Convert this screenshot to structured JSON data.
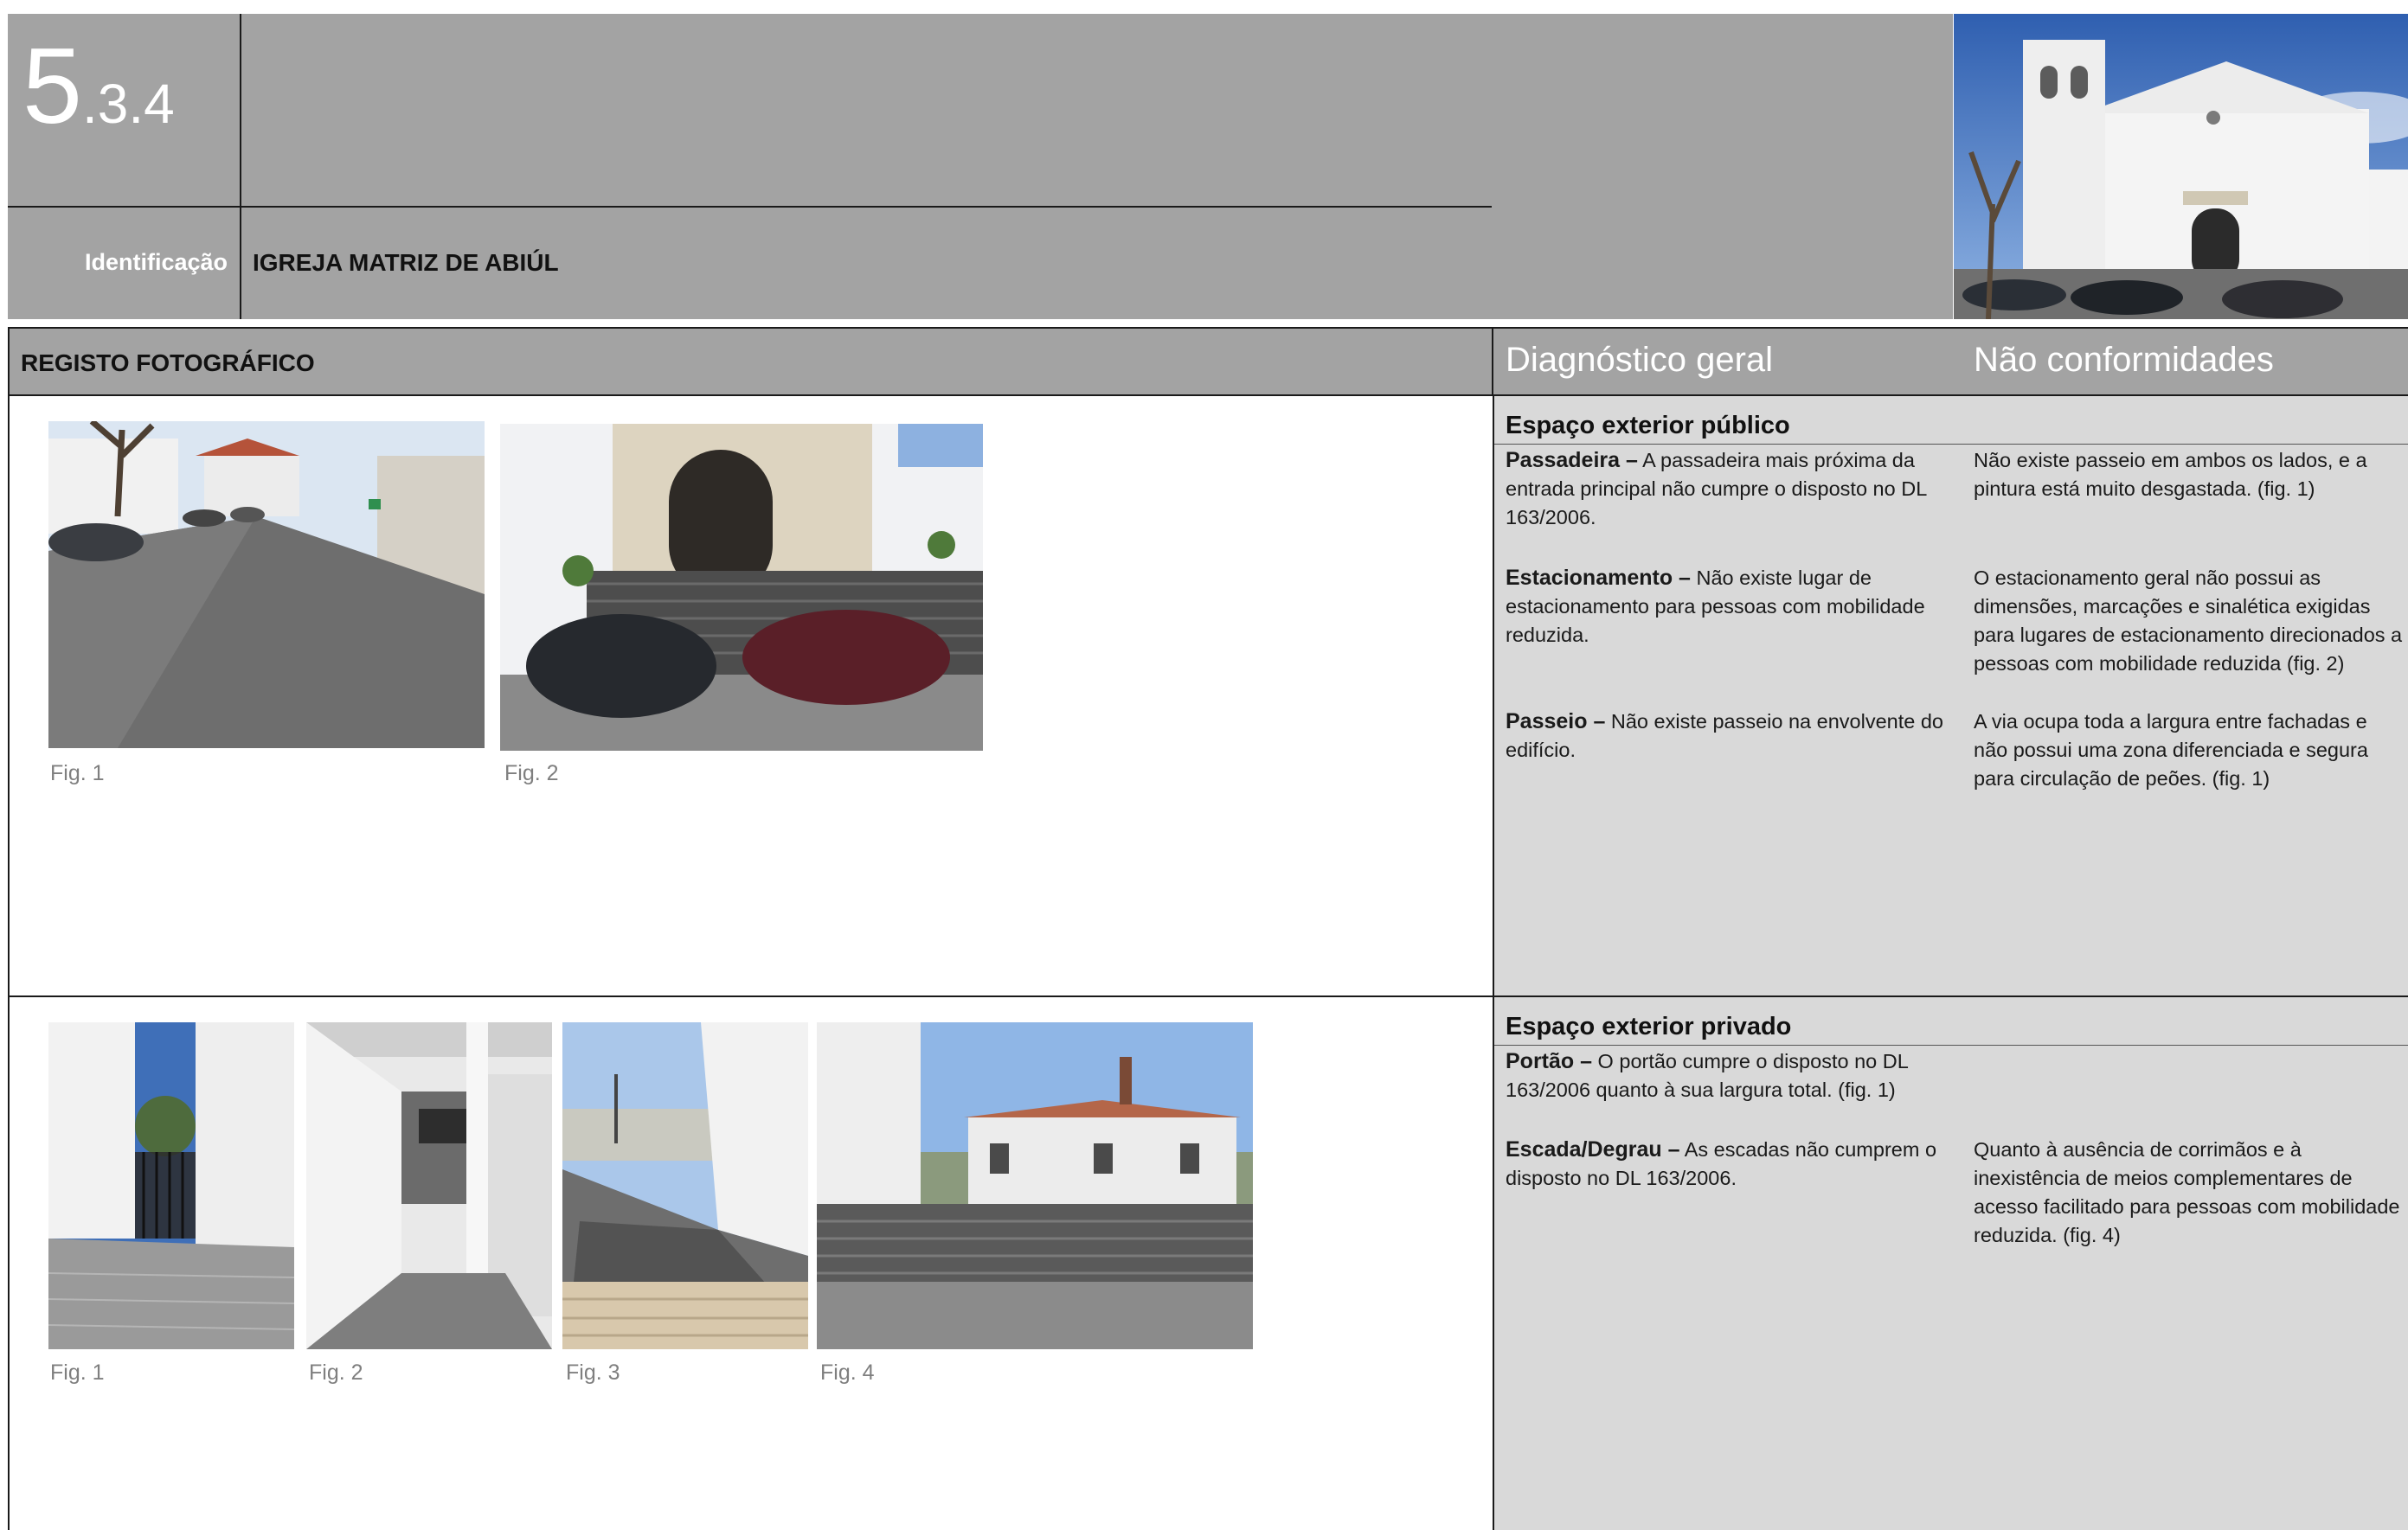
{
  "header": {
    "section_main": "5",
    "section_sub": ".3.4",
    "identification_label": "Identificação",
    "identification_value": "IGREJA MATRIZ DE ABIÚL"
  },
  "sections_bar": {
    "photo_register": "REGISTO FOTOGRÁFICO",
    "general_diagnosis": "Diagnóstico geral",
    "non_conformities": "Não conformidades"
  },
  "public_space": {
    "title": "Espaço exterior público",
    "figures": [
      "Fig. 1",
      "Fig. 2"
    ],
    "items": [
      {
        "term": "Passadeira –",
        "diagnosis": " A passadeira mais próxima da entrada principal não cumpre o disposto no DL 163/2006.",
        "nonconformity": "Não existe passeio em ambos os lados, e a pintura está muito desgastada. (fig. 1)"
      },
      {
        "term": "Estacionamento –",
        "diagnosis": " Não existe lugar de estacionamento para pessoas com mobilidade reduzida.",
        "nonconformity": "O estacionamento geral não possui as dimensões, marcações e sinalética exigidas para lugares de estacionamento direcionados a pessoas com mobilidade reduzida (fig. 2)"
      },
      {
        "term": "Passeio –",
        "diagnosis": " Não existe passeio na envolvente do edifício.",
        "nonconformity": "A via ocupa toda a largura entre fachadas e não possui uma zona diferenciada e segura para circulação de peões. (fig. 1)"
      }
    ]
  },
  "private_space": {
    "title": "Espaço exterior privado",
    "figures": [
      "Fig. 1",
      "Fig. 2",
      "Fig. 3",
      "Fig. 4"
    ],
    "items": [
      {
        "term": "Portão –",
        "diagnosis": " O portão cumpre o disposto no DL 163/2006 quanto à sua largura total. (fig. 1)",
        "nonconformity": ""
      },
      {
        "term": "Escada/Degrau –",
        "diagnosis": " As escadas não cumprem o disposto no DL 163/2006.",
        "nonconformity": "Quanto à ausência de corrimãos e à inexistência de meios complementares de acesso facilitado para pessoas com mobilidade reduzida. (fig. 4)"
      }
    ]
  },
  "colors": {
    "header_gray": "#a3a3a3",
    "panel_gray": "#d9d9d9",
    "caption_gray": "#7f7f7f"
  }
}
